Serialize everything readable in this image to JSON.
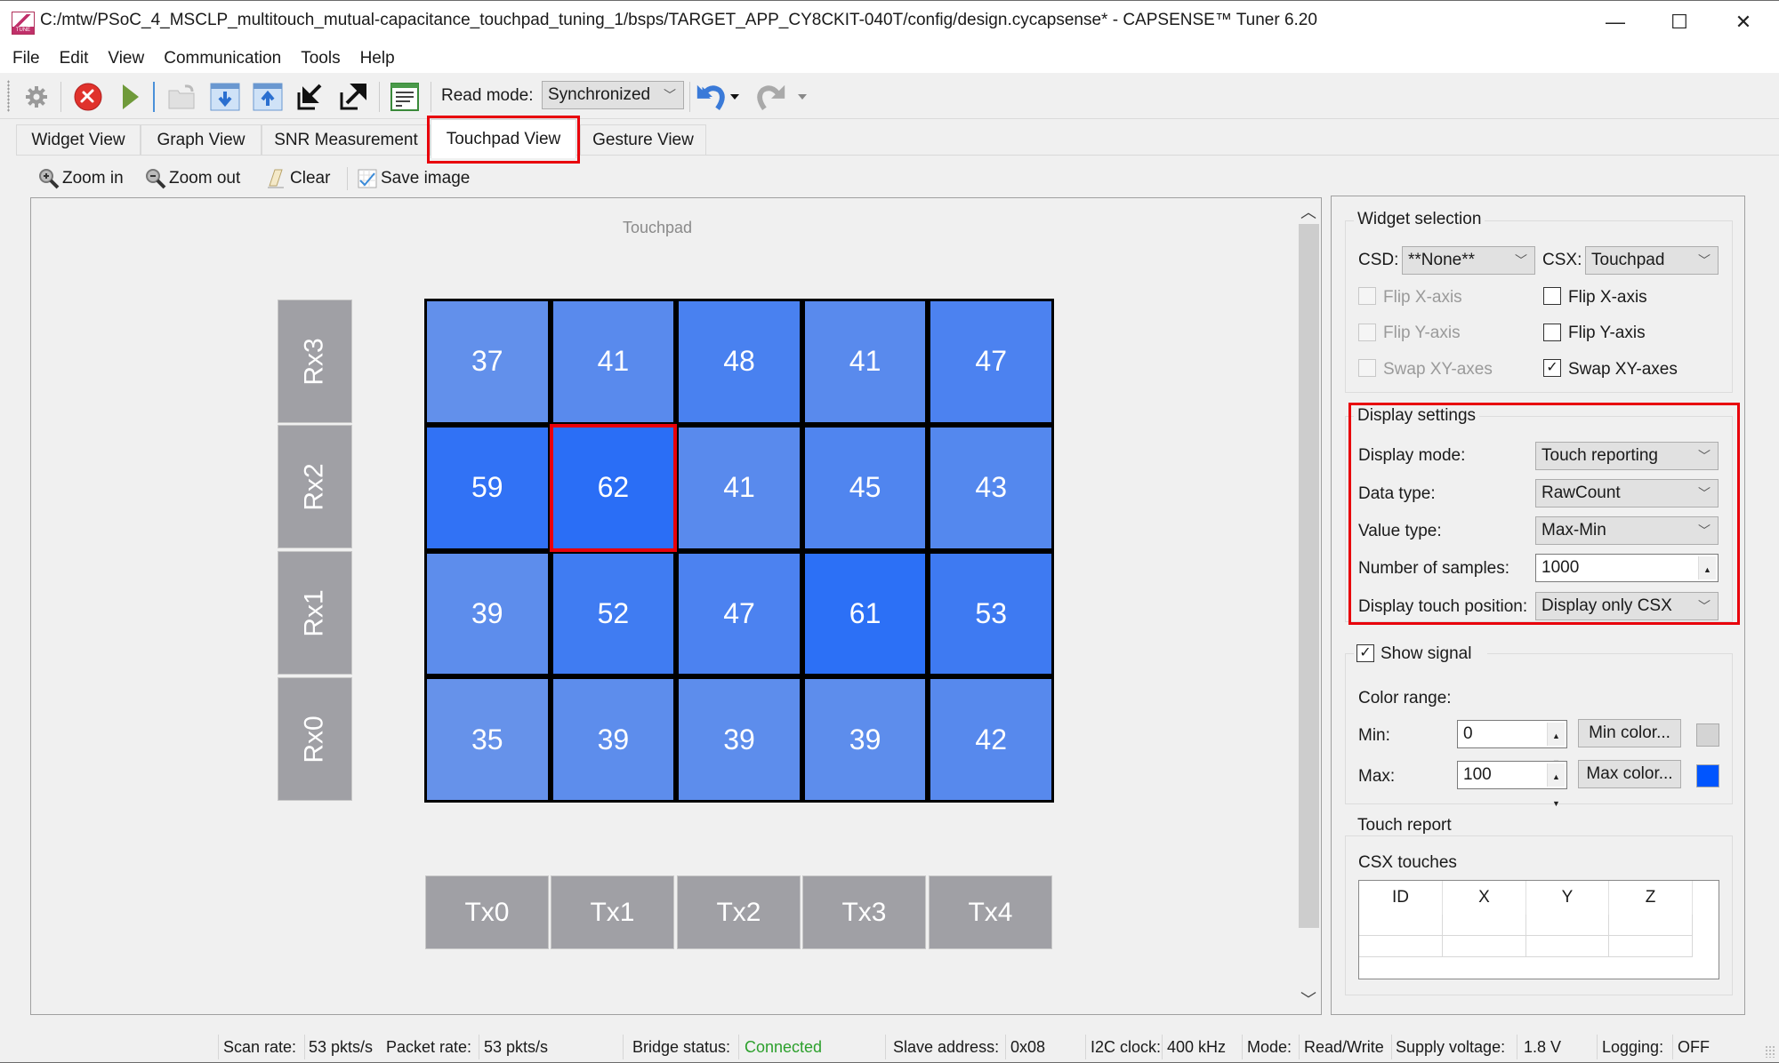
{
  "window": {
    "title": "C:/mtw/PSoC_4_MSCLP_multitouch_mutual-capacitance_touchpad_tuning_1/bsps/TARGET_APP_CY8CKIT-040T/config/design.cycapsense* - CAPSENSE™ Tuner 6.20",
    "app_icon_text": "TUNE",
    "controls": {
      "minimize": "—",
      "maximize": "☐",
      "close": "✕"
    }
  },
  "menu": [
    {
      "label": "File"
    },
    {
      "label": "Edit"
    },
    {
      "label": "View"
    },
    {
      "label": "Communication"
    },
    {
      "label": "Tools"
    },
    {
      "label": "Help"
    }
  ],
  "toolbar": {
    "icons": [
      "gear-icon",
      "disconnect-icon",
      "start-icon",
      "open-icon",
      "read-from-device-icon",
      "write-to-device-icon",
      "import-icon",
      "export-icon",
      "log-icon",
      "undo-icon",
      "redo-icon"
    ],
    "read_mode_label": "Read mode:",
    "read_mode_value": "Synchronized"
  },
  "tabs": [
    {
      "label": "Widget View",
      "active": false
    },
    {
      "label": "Graph View",
      "active": false
    },
    {
      "label": "SNR Measurement",
      "active": false
    },
    {
      "label": "Touchpad View",
      "active": true
    },
    {
      "label": "Gesture View",
      "active": false
    }
  ],
  "subtoolbar": {
    "zoom_in": "Zoom in",
    "zoom_out": "Zoom out",
    "clear": "Clear",
    "save_image": "Save image"
  },
  "touchpad": {
    "title": "Touchpad",
    "rx_labels": [
      "Rx3",
      "Rx2",
      "Rx1",
      "Rx0"
    ],
    "tx_labels": [
      "Tx0",
      "Tx1",
      "Tx2",
      "Tx3",
      "Tx4"
    ],
    "values": [
      [
        37,
        41,
        48,
        41,
        47
      ],
      [
        59,
        62,
        41,
        45,
        43
      ],
      [
        39,
        52,
        47,
        61,
        53
      ],
      [
        35,
        39,
        39,
        39,
        42
      ]
    ],
    "selected_cell": {
      "rx": "Rx2",
      "tx": "Tx1"
    },
    "color_min": "#d4d4d4",
    "color_max": "#0055ff",
    "label_color": "#a0a0a5",
    "highlight_color": "#e8000b"
  },
  "widget_selection": {
    "title": "Widget selection",
    "csd_label": "CSD:",
    "csd_value": "**None**",
    "csx_label": "CSX:",
    "csx_value": "Touchpad",
    "csd_options": [
      {
        "label": "Flip X-axis",
        "checked": false,
        "enabled": false
      },
      {
        "label": "Flip Y-axis",
        "checked": false,
        "enabled": false
      },
      {
        "label": "Swap XY-axes",
        "checked": false,
        "enabled": false
      }
    ],
    "csx_options": [
      {
        "label": "Flip X-axis",
        "checked": false,
        "enabled": true
      },
      {
        "label": "Flip Y-axis",
        "checked": false,
        "enabled": true
      },
      {
        "label": "Swap XY-axes",
        "checked": true,
        "enabled": true
      }
    ]
  },
  "display_settings": {
    "title": "Display settings",
    "display_mode_label": "Display mode:",
    "display_mode_value": "Touch reporting",
    "data_type_label": "Data type:",
    "data_type_value": "RawCount",
    "value_type_label": "Value type:",
    "value_type_value": "Max-Min",
    "samples_label": "Number of samples:",
    "samples_value": "1000",
    "touch_position_label": "Display touch position:",
    "touch_position_value": "Display only CSX"
  },
  "show_signal": {
    "label": "Show signal",
    "checked": true,
    "color_range_label": "Color range:",
    "min_label": "Min:",
    "min_value": "0",
    "min_color_button": "Min color...",
    "min_color": "#d4d4d4",
    "max_label": "Max:",
    "max_value": "100",
    "max_color_button": "Max color...",
    "max_color": "#0055ff"
  },
  "touch_report": {
    "title": "Touch report",
    "csx_touches_label": "CSX touches",
    "columns": [
      "ID",
      "X",
      "Y",
      "Z"
    ],
    "rows": []
  },
  "statusbar": {
    "scan_rate_label": "Scan rate:",
    "scan_rate_value": "53 pkts/s",
    "packet_rate_label": "Packet rate:",
    "packet_rate_value": "53 pkts/s",
    "bridge_status_label": "Bridge status:",
    "bridge_status_value": "Connected",
    "bridge_status_color": "#2ca02c",
    "slave_address_label": "Slave address:",
    "slave_address_value": "0x08",
    "i2c_clock_label": "I2C clock:",
    "i2c_clock_value": "400 kHz",
    "mode_label": "Mode:",
    "mode_value": "Read/Write",
    "supply_voltage_label": "Supply voltage:",
    "supply_voltage_value": "1.8 V",
    "logging_label": "Logging:",
    "logging_value": "OFF"
  }
}
